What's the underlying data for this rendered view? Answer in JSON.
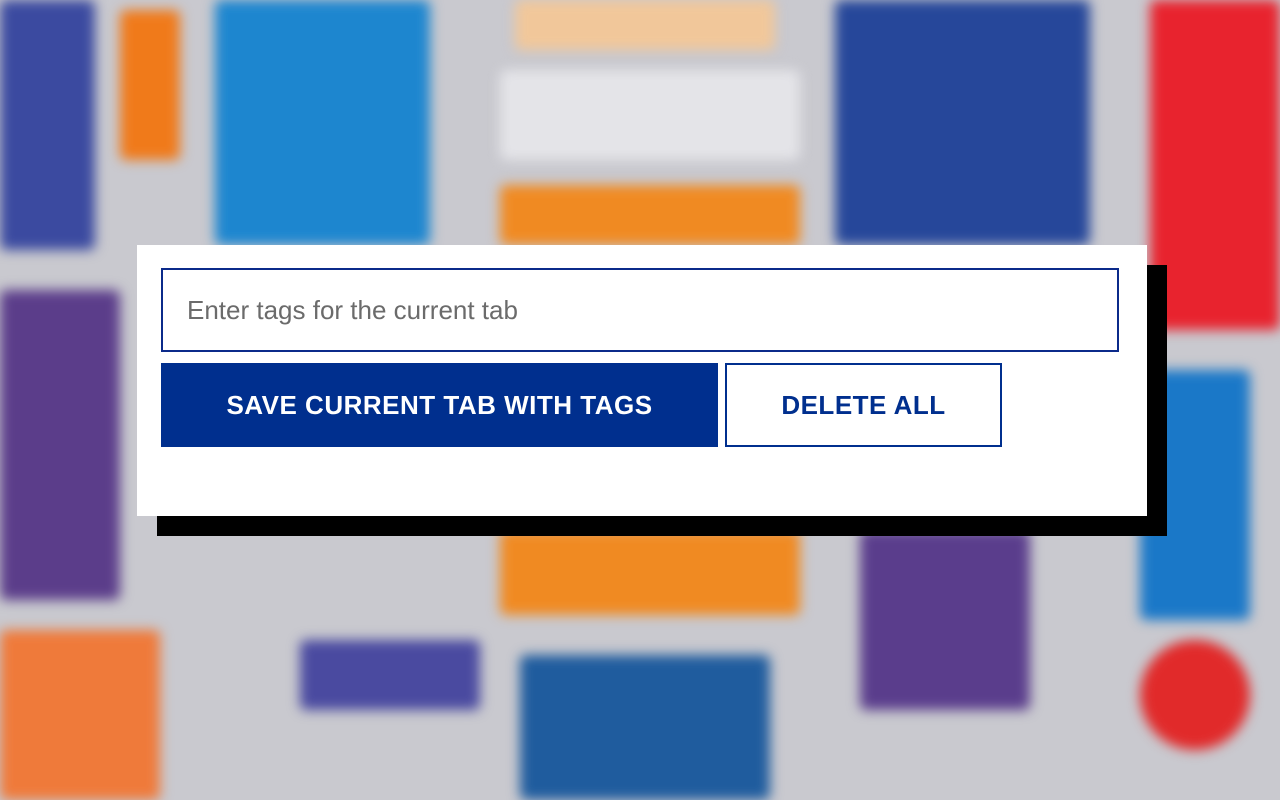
{
  "tag_input": {
    "placeholder": "Enter tags for the current tab",
    "value": ""
  },
  "buttons": {
    "save_label": "SAVE CURRENT TAB WITH TAGS",
    "delete_label": "DELETE ALL"
  },
  "colors": {
    "primary": "#002f8e",
    "popup_background": "#ffffff",
    "shadow": "#000000"
  }
}
